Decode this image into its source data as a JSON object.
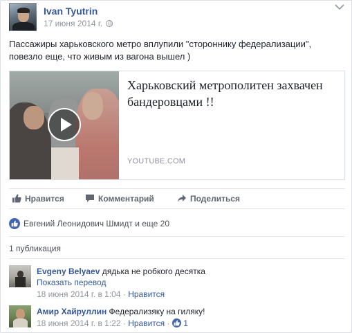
{
  "post": {
    "author": "Ivan Tyutrin",
    "date": "17 июня 2014 г.",
    "text": "Пассажиры харьковского метро вплупили \"стороннику федерализации\", повезло еще, что живым из вагона вышел )",
    "link": {
      "title": "Харьковский метрополитен захвачен бандеровцами !!",
      "domain": "YOUTUBE.COM"
    }
  },
  "actions": {
    "like": "Нравится",
    "comment": "Комментарий",
    "share": "Поделиться"
  },
  "reactions": {
    "text": "Евгений Леонидович Шмидт и еще 20"
  },
  "shares": {
    "text": "1 публикация"
  },
  "comments": [
    {
      "author": "Evgeny Belyaev",
      "text": "дядька не робкого десятка",
      "translate": "Показать перевод",
      "time": "18 июня 2014 г. в 1:04",
      "sep": "·",
      "like_label": "Нравится"
    },
    {
      "author": "Амир Хайруллин",
      "text": "Федерализяку на гиляку!",
      "time": "18 июня 2014 г. в 1:22",
      "sep": "·",
      "like_label": "Нравится",
      "sep2": "·",
      "likes_count": "1"
    }
  ],
  "colors": {
    "link_blue": "#365899",
    "like_blue": "#4267b2",
    "meta_gray": "#90949c"
  },
  "icons": {
    "post_menu": "chevron-down-icon",
    "privacy": "globe-icon",
    "like": "thumbs-up-icon",
    "comment": "speech-bubble-icon",
    "share": "share-arrow-icon",
    "video": "play-icon"
  }
}
